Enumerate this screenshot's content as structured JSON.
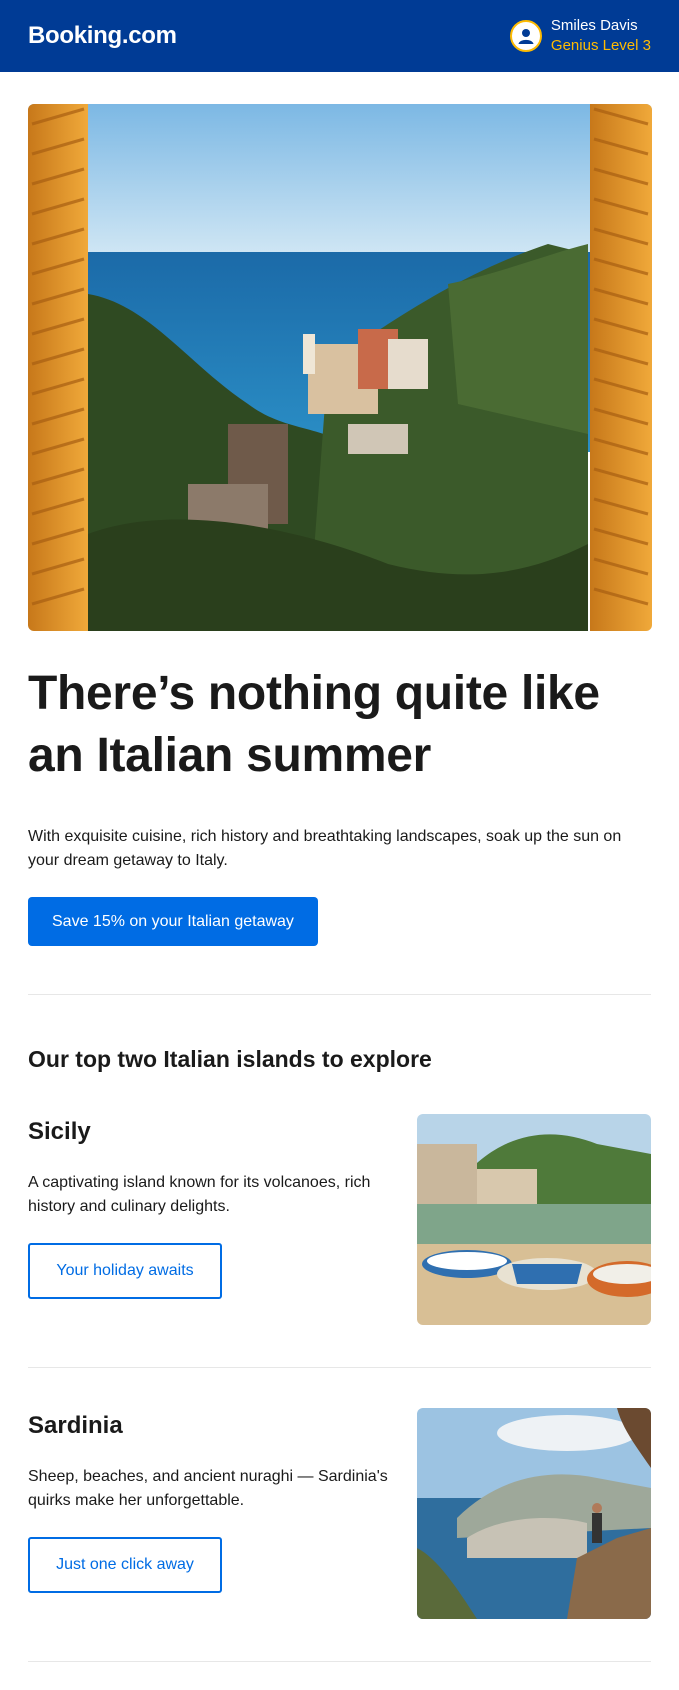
{
  "header": {
    "logo": "Booking.com",
    "user_name": "Smiles Davis",
    "genius_level": "Genius Level 3",
    "avatar_icon": "user-avatar-icon",
    "colors": {
      "brand": "#003b95",
      "genius": "#febb02"
    }
  },
  "hero": {
    "title": "There’s nothing quite like an Italian summer",
    "description": "With exquisite cuisine, rich history and breathtaking landscapes, soak up the sun on your dream getaway to Italy.",
    "cta_label": "Save 15% on your Italian getaway"
  },
  "islands_section": {
    "heading": "Our top two Italian islands to explore",
    "islands": [
      {
        "name": "Sicily",
        "description": "A captivating island known for its volcanoes, rich history and culinary delights.",
        "button_label": "Your holiday awaits"
      },
      {
        "name": "Sardinia",
        "description": "Sheep, beaches, and ancient nuraghi — Sardinia's quirks make her unforgettable.",
        "button_label": "Just one click away"
      }
    ]
  },
  "colors": {
    "primary_button": "#006ce4",
    "divider": "#e7e7e7"
  }
}
